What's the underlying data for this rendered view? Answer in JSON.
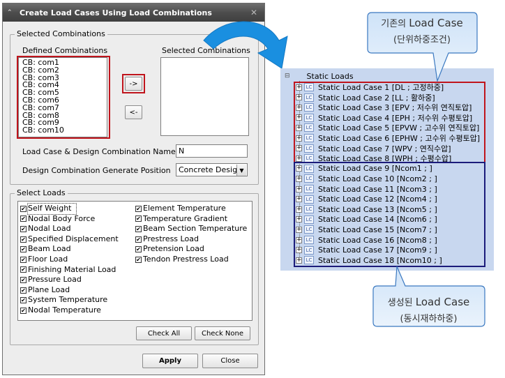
{
  "dialog": {
    "title": "Create Load Cases Using Load Combinations",
    "selected_combinations_group": "Selected Combinations",
    "defined_label": "Defined Combinations",
    "selected_label": "Selected Combinations",
    "defined_items": [
      "CB: com1",
      "CB: com2",
      "CB: com3",
      "CB: com4",
      "CB: com5",
      "CB: com6",
      "CB: com7",
      "CB: com8",
      "CB: com9",
      "CB: com10"
    ],
    "add_button": "->",
    "remove_button": "<-",
    "name_label": "Load Case & Design Combination Name",
    "name_value": "N",
    "position_label": "Design Combination Generate Position",
    "position_value": "Concrete Desig",
    "select_loads_group": "Select Loads",
    "loads_left": [
      "Self Weight",
      "Nodal Body Force",
      "Nodal Load",
      "Specified Displacement",
      "Beam Load",
      "Floor Load",
      "Finishing Material Load",
      "Pressure Load",
      "Plane Load",
      "System Temperature",
      "Nodal Temperature"
    ],
    "loads_right": [
      "Element Temperature",
      "Temperature Gradient",
      "Beam Section Temperature",
      "Prestress Load",
      "Pretension Load",
      "Tendon Prestress Load"
    ],
    "check_all": "Check All",
    "check_none": "Check None",
    "apply": "Apply",
    "close": "Close"
  },
  "tree": {
    "root": "Static Loads",
    "items": [
      "Static Load Case 1 [DL ; 고정하중]",
      "Static Load Case 2 [LL ; 활하중]",
      "Static Load Case 3 [EPV ; 저수위 연직토압]",
      "Static Load Case 4 [EPH ; 저수위 수평토압]",
      "Static Load Case 5 [EPVW ; 고수위 연직토압]",
      "Static Load Case 6 [EPHW ; 고수위 수평토압]",
      "Static Load Case 7 [WPV ; 연직수압]",
      "Static Load Case 8 [WPH ; 수평수압]",
      "Static Load Case 9 [Ncom1 ; ]",
      "Static Load Case 10 [Ncom2 ; ]",
      "Static Load Case 11 [Ncom3 ; ]",
      "Static Load Case 12 [Ncom4 ; ]",
      "Static Load Case 13 [Ncom5 ; ]",
      "Static Load Case 14 [Ncom6 ; ]",
      "Static Load Case 15 [Ncom7 ; ]",
      "Static Load Case 16 [Ncom8 ; ]",
      "Static Load Case 17 [Ncom9 ; ]",
      "Static Load Case 18 [Ncom10 ; ]"
    ],
    "icon_text": "LC"
  },
  "callouts": {
    "top_prefix": "기존의",
    "top_big": "Load Case",
    "top_sub": "(단위하중조건)",
    "bottom_prefix": "생성된",
    "bottom_big": "Load Case",
    "bottom_sub": "(동시재하하중)"
  },
  "colors": {
    "highlight_red": "#c0141c",
    "highlight_blue": "#1b1b7a",
    "tree_bg": "#c8d7ef",
    "arrow_blue": "#1a8fe0"
  }
}
